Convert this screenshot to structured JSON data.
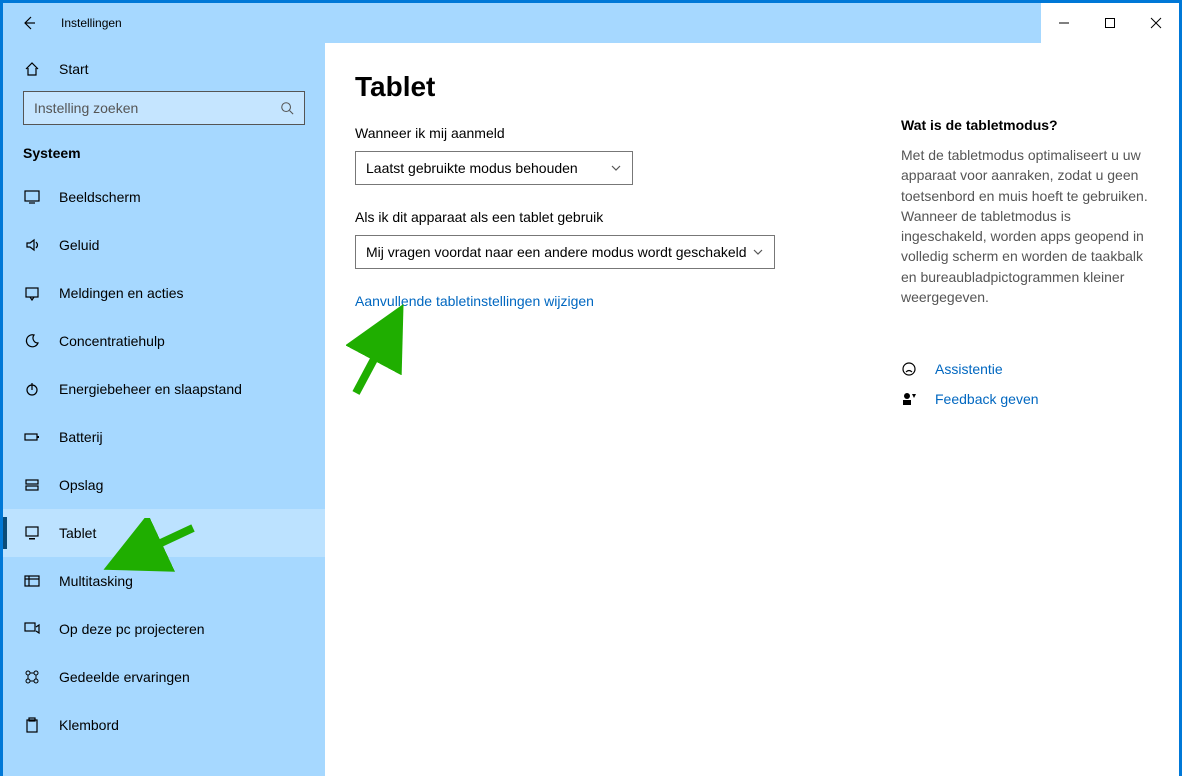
{
  "window": {
    "title": "Instellingen"
  },
  "sidebar": {
    "home": "Start",
    "search_placeholder": "Instelling zoeken",
    "section": "Systeem",
    "items": [
      {
        "label": "Beeldscherm",
        "icon": "display"
      },
      {
        "label": "Geluid",
        "icon": "sound"
      },
      {
        "label": "Meldingen en acties",
        "icon": "notify"
      },
      {
        "label": "Concentratiehulp",
        "icon": "moon"
      },
      {
        "label": "Energiebeheer en slaapstand",
        "icon": "power"
      },
      {
        "label": "Batterij",
        "icon": "battery"
      },
      {
        "label": "Opslag",
        "icon": "storage"
      },
      {
        "label": "Tablet",
        "icon": "tablet",
        "selected": true
      },
      {
        "label": "Multitasking",
        "icon": "multitask"
      },
      {
        "label": "Op deze pc projecteren",
        "icon": "project"
      },
      {
        "label": "Gedeelde ervaringen",
        "icon": "share"
      },
      {
        "label": "Klembord",
        "icon": "clipboard"
      }
    ]
  },
  "main": {
    "title": "Tablet",
    "signin_label": "Wanneer ik mij aanmeld",
    "signin_value": "Laatst gebruikte modus behouden",
    "tablet_use_label": "Als ik dit apparaat als een tablet gebruik",
    "tablet_use_value": "Mij vragen voordat naar een andere modus wordt geschakeld",
    "more_link": "Aanvullende tabletinstellingen wijzigen"
  },
  "aside": {
    "heading": "Wat is de tabletmodus?",
    "body": "Met de tabletmodus optimaliseert u uw apparaat voor aanraken, zodat u geen toetsenbord en muis hoeft te gebruiken. Wanneer de tabletmodus is ingeschakeld, worden apps geopend in volledig scherm en worden de taakbalk en bureaubladpictogrammen kleiner weergegeven.",
    "help": "Assistentie",
    "feedback": "Feedback geven"
  }
}
